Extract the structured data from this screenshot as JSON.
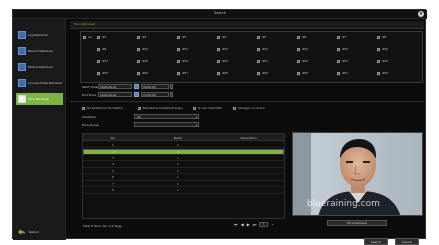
{
  "window": {
    "title": "Search",
    "close_glyph": "×"
  },
  "sidebar": {
    "items": [
      {
        "label": "Log Retrieval",
        "icon": "document-icon"
      },
      {
        "label": "Record Retrieval",
        "icon": "film-icon"
      },
      {
        "label": "Picture Retrieval",
        "icon": "picture-icon"
      },
      {
        "label": "License Plate Retrieval",
        "icon": "car-icon"
      },
      {
        "label": "Face Retrieval",
        "icon": "face-icon"
      }
    ],
    "return_label": "Return"
  },
  "section_title": "Face Retrieval",
  "channels": {
    "all_label": "All",
    "items": [
      "IP1",
      "IP2",
      "IP3",
      "IP4",
      "IP5",
      "IP6",
      "IP7",
      "IP8",
      "IP9",
      "IP10",
      "IP11",
      "IP12",
      "IP13",
      "IP14",
      "IP15",
      "IP16",
      "IP17",
      "IP18",
      "IP19",
      "IP20",
      "IP21",
      "IP22",
      "IP23",
      "IP24",
      "IP25",
      "IP26",
      "IP27",
      "IP28",
      "IP29",
      "IP30",
      "IP31",
      "IP32"
    ]
  },
  "time": {
    "start_label": "Start Time",
    "start_date": "2018-06-20",
    "start_time": "00:00:00",
    "end_label": "End Time",
    "end_date": "2018-06-20",
    "end_time": "23:59:59"
  },
  "filters": [
    "No additional information",
    "Blacklist and watch/stranger",
    "Is over mismatch",
    "Stranger on record"
  ],
  "similarity": {
    "label": "Similarity",
    "value": "60"
  },
  "face_group": {
    "label": "Face Group",
    "value": ""
  },
  "table": {
    "headers": [
      "No.",
      "Name",
      "Description"
    ],
    "rows": [
      {
        "no": "1",
        "name": "1",
        "desc": ""
      },
      {
        "no": "2",
        "name": "1",
        "desc": ""
      },
      {
        "no": "3",
        "name": "1",
        "desc": ""
      },
      {
        "no": "4",
        "name": "1",
        "desc": ""
      },
      {
        "no": "5",
        "name": "1",
        "desc": ""
      },
      {
        "no": "6",
        "name": "1",
        "desc": ""
      },
      {
        "no": "7",
        "name": "1",
        "desc": ""
      },
      {
        "no": "8",
        "name": "1",
        "desc": ""
      }
    ],
    "selected_row": 1
  },
  "total_text": "Total 8 Item: No. 1/1 Page",
  "page_box": "1",
  "preview": {
    "watermark": "blueraining.com",
    "face_label": "Face Retrieval"
  },
  "buttons": {
    "search": "Search",
    "cancel": "Cancel"
  },
  "colors": {
    "accent": "#7cb342",
    "background": "#0c0c0c",
    "panel": "#1a1a1a"
  }
}
